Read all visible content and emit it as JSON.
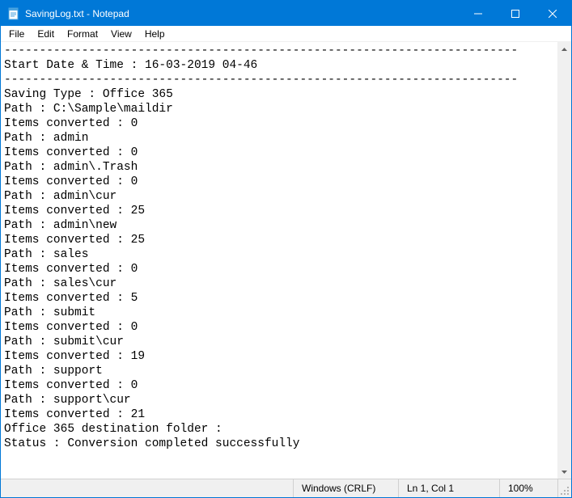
{
  "window": {
    "title": "SavingLog.txt - Notepad"
  },
  "menu": {
    "file": "File",
    "edit": "Edit",
    "format": "Format",
    "view": "View",
    "help": "Help"
  },
  "document": {
    "lines": [
      "-------------------------------------------------------------------------",
      "Start Date & Time : 16-03-2019 04-46",
      "-------------------------------------------------------------------------",
      "Saving Type : Office 365",
      "Path : C:\\Sample\\maildir",
      "Items converted : 0",
      "Path : admin",
      "Items converted : 0",
      "Path : admin\\.Trash",
      "Items converted : 0",
      "Path : admin\\cur",
      "Items converted : 25",
      "Path : admin\\new",
      "Items converted : 25",
      "Path : sales",
      "Items converted : 0",
      "Path : sales\\cur",
      "Items converted : 5",
      "Path : submit",
      "Items converted : 0",
      "Path : submit\\cur",
      "Items converted : 19",
      "Path : support",
      "Items converted : 0",
      "Path : support\\cur",
      "Items converted : 21",
      "Office 365 destination folder :",
      "Status : Conversion completed successfully"
    ]
  },
  "statusbar": {
    "encoding": "Windows (CRLF)",
    "position": "Ln 1, Col 1",
    "zoom": "100%"
  }
}
